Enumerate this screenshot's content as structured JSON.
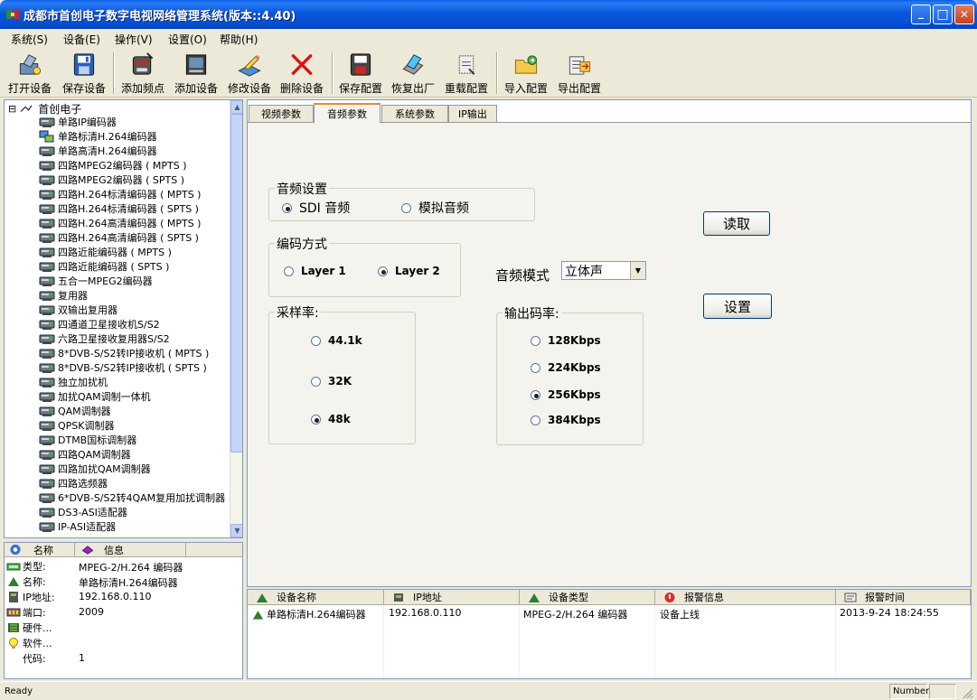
{
  "window": {
    "title": "成都市首创电子数字电视网络管理系统(版本::4.40)",
    "minimize": "_",
    "maximize": "□",
    "close": "✕"
  },
  "menu": [
    "系统(S)",
    "设备(E)",
    "操作(V)",
    "设置(O)",
    "帮助(H)"
  ],
  "toolbar": [
    {
      "label": "打开设备",
      "icon": "open-device-icon"
    },
    {
      "label": "保存设备",
      "icon": "save-device-icon"
    },
    {
      "label": "添加频点",
      "icon": "add-frequency-icon"
    },
    {
      "label": "添加设备",
      "icon": "add-device-icon"
    },
    {
      "label": "修改设备",
      "icon": "edit-device-icon"
    },
    {
      "label": "删除设备",
      "icon": "delete-device-icon"
    },
    {
      "label": "保存配置",
      "icon": "save-config-icon"
    },
    {
      "label": "恢复出厂",
      "icon": "factory-reset-icon"
    },
    {
      "label": "重载配置",
      "icon": "reload-config-icon"
    },
    {
      "label": "导入配置",
      "icon": "import-config-icon"
    },
    {
      "label": "导出配置",
      "icon": "export-config-icon"
    }
  ],
  "tree": {
    "expander": "⊟",
    "root": "首创电子",
    "items": [
      "单路IP编码器",
      "单路标清H.264编码器",
      "单路高清H.264编码器",
      "四路MPEG2编码器 ( MPTS )",
      "四路MPEG2编码器 ( SPTS )",
      "四路H.264标清编码器 ( MPTS )",
      "四路H.264标清编码器 ( SPTS )",
      "四路H.264高清编码器 ( MPTS )",
      "四路H.264高清编码器 ( SPTS )",
      "四路近能编码器 ( MPTS )",
      "四路近能编码器 ( SPTS )",
      "五合一MPEG2编码器",
      "复用器",
      "双输出复用器",
      "四通道卫星接收机S/S2",
      "六路卫星接收复用器S/S2",
      "8*DVB-S/S2转IP接收机 ( MPTS )",
      "8*DVB-S/S2转IP接收机 ( SPTS )",
      "独立加扰机",
      "加扰QAM调制一体机",
      "QAM调制器",
      "QPSK调制器",
      "DTMB国标调制器",
      "四路QAM调制器",
      "四路加扰QAM调制器",
      "四路选频器",
      "6*DVB-S/S2转4QAM复用加扰调制器",
      "DS3-ASI适配器",
      "IP-ASI适配器"
    ],
    "selected_index": 1
  },
  "info": {
    "headers": [
      "名称",
      "信息"
    ],
    "rows": [
      {
        "label": "类型:",
        "value": "MPEG-2/H.264 编码器"
      },
      {
        "label": "名称:",
        "value": "单路标清H.264编码器"
      },
      {
        "label": "IP地址:",
        "value": "192.168.0.110"
      },
      {
        "label": "端口:",
        "value": "2009"
      },
      {
        "label": "硬件...",
        "value": ""
      },
      {
        "label": "软件...",
        "value": ""
      },
      {
        "label": "代码:",
        "value": "1"
      }
    ]
  },
  "tabs": [
    "视频参数",
    "音频参数",
    "系统参数",
    "IP输出"
  ],
  "active_tab": 1,
  "audio": {
    "settings_group": "音频设置",
    "sdi": "SDI 音频",
    "analog": "模拟音频",
    "source_selected": "sdi",
    "encoding_group": "编码方式",
    "layer1": "Layer 1",
    "layer2": "Layer 2",
    "encoding_selected": "layer2",
    "mode_label": "音频模式",
    "mode_value": "立体声",
    "sample_group": "采样率:",
    "sample_rates": [
      "44.1k",
      "32K",
      "48k"
    ],
    "sample_selected": 2,
    "bitrate_group": "输出码率:",
    "bitrates": [
      "128Kbps",
      "224Kbps",
      "256Kbps",
      "384Kbps"
    ],
    "bitrate_selected": 2,
    "read_button": "读取",
    "set_button": "设置"
  },
  "device_list": {
    "headers": [
      "设备名称",
      "IP地址",
      "设备类型",
      "报警信息",
      "报警时间"
    ],
    "rows": [
      {
        "name": "单路标清H.264编码器",
        "ip": "192.168.0.110",
        "type": "MPEG-2/H.264 编码器",
        "alarm": "设备上线",
        "time": "2013-9-24 18:24:55"
      }
    ]
  },
  "status": {
    "text": "Ready",
    "number": "Number"
  },
  "colors": {
    "title_blue": "#0856dc",
    "tab_active_accent": "#e68b2c",
    "panel_border": "#7f9db9"
  }
}
